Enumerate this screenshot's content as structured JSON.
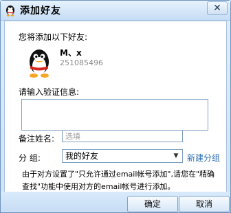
{
  "window": {
    "title": "添加好友"
  },
  "dialog": {
    "intro_label": "您将添加以下好友:",
    "friend": {
      "name": "M、x",
      "qq_number": "251085496"
    },
    "verification_label": "请输入验证信息:",
    "verification_value": "",
    "remark_label": "备注姓名:",
    "remark_placeholder": "选填",
    "group_label": "分  组:",
    "group_selected": "我的好友",
    "new_group_link": "新建分组",
    "note": "由于对方设置了\"只允许通过email帐号添加\",请您在\"精确查找\"功能中使用对方的email帐号进行添加。"
  },
  "buttons": {
    "ok": "确定",
    "cancel": "取消"
  },
  "icons": {
    "window_icon": "qq-penguin-icon",
    "avatar": "qq-penguin-avatar",
    "close": "close-icon",
    "dropdown": "chevron-down-icon"
  },
  "colors": {
    "link": "#2b6cb0",
    "window_border": "#6f93bd"
  }
}
